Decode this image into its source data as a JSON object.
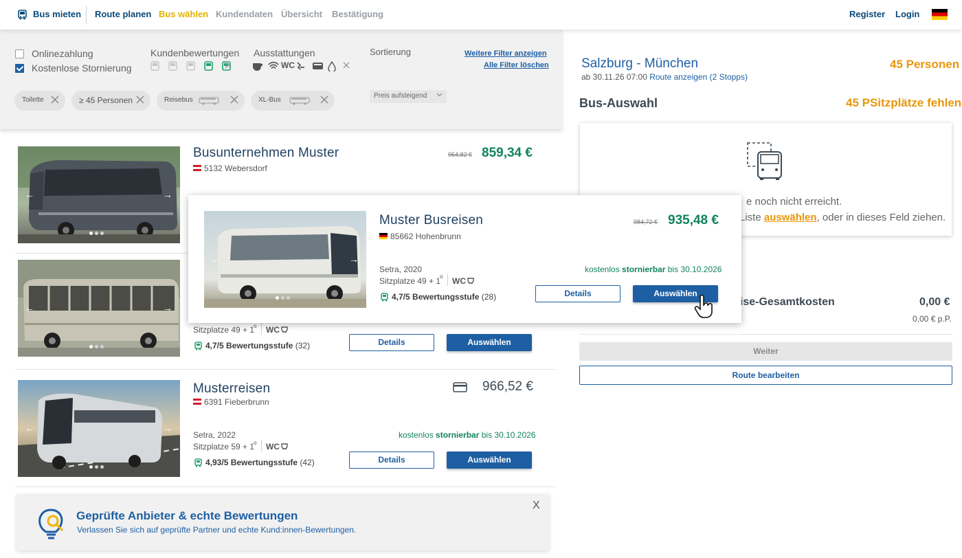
{
  "nav": {
    "brand": "Bus mieten",
    "steps": [
      "Route planen",
      "Bus wählen",
      "Kundendaten",
      "Übersicht",
      "Bestätigung"
    ],
    "register": "Register",
    "login": "Login"
  },
  "filters": {
    "online_payment": "Onlinezahlung",
    "free_cancel": "Kostenlose Stornierung",
    "reviews_label": "Kundenbewertungen",
    "features_label": "Ausstattungen",
    "features_wc": "WC",
    "sort_label": "Sortierung",
    "sort_value": "Preis aufsteigend",
    "more_filters": "Weitere Filter anzeigen",
    "clear_filters": "Alle Filter löschen",
    "chips": [
      "Toilette",
      "≥ 45 Personen",
      "Reisebus",
      "XL-Bus"
    ]
  },
  "listings": [
    {
      "company": "Busunternehmen Muster",
      "location": "5132 Webersdorf",
      "old_price": "954,82 €",
      "price": "859,34 €"
    },
    {
      "seats": "Sitzplatze 49 + 1",
      "wc": "WC",
      "rating": "4,7/5 Bewertungsstufe",
      "rating_count": "(32)",
      "details": "Details",
      "select": "Auswählen"
    },
    {
      "company": "Musterreisen",
      "location": "6391 Fieberbrunn",
      "price": "966,52 €",
      "model": "Setra, 2022",
      "seats": "Sitzplatze 59 + 1",
      "wc": "WC",
      "storno_pre": "kostenlos",
      "storno_bold": "stornierbar",
      "storno_post": "bis 30.10.2026",
      "rating": "4,93/5 Bewertungsstufe",
      "rating_count": "(42)",
      "details": "Details",
      "select": "Auswählen"
    }
  ],
  "popup": {
    "company": "Muster Busreisen",
    "location": "85662 Hohenbrunn",
    "old_price": "984,72 €",
    "price": "935,48 €",
    "model": "Setra, 2020",
    "seats": "Sitzplatze 49 + 1",
    "wc": "WC",
    "storno_pre": "kostenlos",
    "storno_bold": "stornierbar",
    "storno_post": "bis 30.10.2026",
    "rating": "4,7/5 Bewertungsstufe",
    "rating_count": "(28)",
    "details": "Details",
    "select": "Auswählen"
  },
  "banner": {
    "title": "Geprüfte Anbieter & echte Bewertungen",
    "text": "Verlassen Sie sich auf geprüfte Partner und echte Kund:innen-Bewertungen.",
    "close": "X"
  },
  "trip": {
    "route": "Salzburg - München",
    "date_prefix": "ab 30.11.26 07:00",
    "route_link": "Route anzeigen (2 Stopps)",
    "persons": "45 Personen",
    "section": "Bus-Auswahl",
    "missing": "45 PSitzplätze fehlen",
    "dz_line1": "e noch nicht erreicht.",
    "dz_line2_pre": "Liste",
    "dz_line2_link": "auswählen",
    "dz_line2_post": ", oder in dieses Feld ziehen.",
    "cost_label": "eise-Gesamtkosten",
    "cost_value": "0,00 €",
    "cost_pp": "0,00 € p.P.",
    "next": "Weiter",
    "edit_route": "Route bearbeiten"
  },
  "colors": {
    "brand_blue": "#1e5fa3",
    "price_green": "#12835e",
    "accent_orange": "#e8960c",
    "step_active": "#e0b300"
  }
}
